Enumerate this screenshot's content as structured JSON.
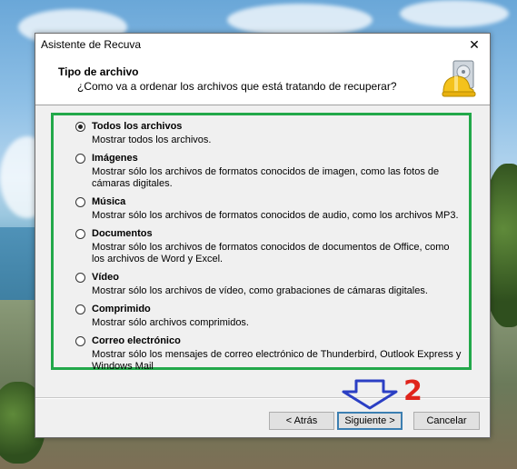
{
  "window": {
    "title": "Asistente de Recuva",
    "close_glyph": "✕"
  },
  "header": {
    "title": "Tipo de archivo",
    "subtitle": "¿Como va a ordenar los archivos que está tratando de recuperar?",
    "logo_icon": "recuva-hardhat-drive-icon"
  },
  "options": [
    {
      "label": "Todos los archivos",
      "desc": "Mostrar todos los archivos.",
      "checked": true
    },
    {
      "label": "Imágenes",
      "desc": "Mostrar sólo los archivos de formatos conocidos de imagen, como las fotos de cámaras digitales.",
      "checked": false
    },
    {
      "label": "Música",
      "desc": "Mostrar sólo los archivos de formatos conocidos de audio, como los archivos MP3.",
      "checked": false
    },
    {
      "label": "Documentos",
      "desc": "Mostrar sólo los archivos de formatos conocidos de documentos de Office, como los archivos de Word y Excel.",
      "checked": false
    },
    {
      "label": "Vídeo",
      "desc": "Mostrar sólo los archivos de vídeo, como grabaciones de cámaras digitales.",
      "checked": false
    },
    {
      "label": "Comprimido",
      "desc": "Mostrar sólo archivos comprimidos.",
      "checked": false
    },
    {
      "label": "Correo electrónico",
      "desc": "Mostrar sólo los mensajes de correo electrónico de Thunderbird, Outlook Express y Windows Mail",
      "checked": false
    }
  ],
  "buttons": {
    "back": "< Atrás",
    "next": "Siguiente >",
    "cancel": "Cancelar"
  },
  "annotation": {
    "number": "2",
    "arrow_color": "#2b3fc4",
    "number_color": "#e0241b",
    "box_color": "#22a84a"
  }
}
